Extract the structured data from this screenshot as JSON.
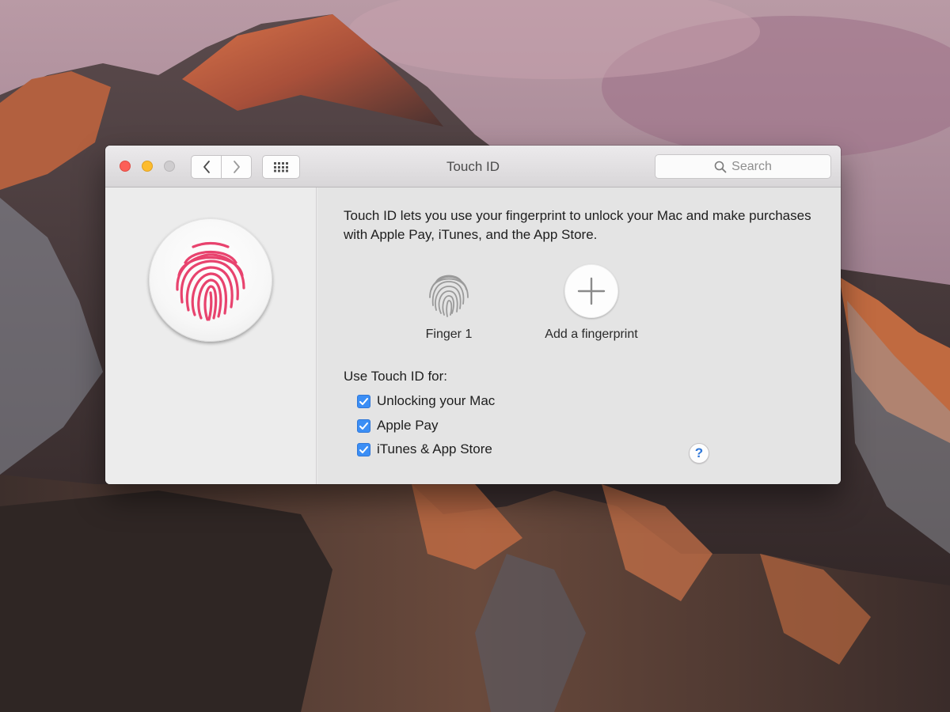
{
  "window": {
    "title": "Touch ID",
    "search_placeholder": "Search"
  },
  "toolbar": {
    "back_icon": "chevron-left-icon",
    "forward_icon": "chevron-right-icon",
    "show_all_icon": "grid-icon"
  },
  "content": {
    "intro": "Touch ID lets you use your fingerprint to unlock your Mac and make purchases with Apple Pay, iTunes, and the App Store.",
    "fingerprints": [
      {
        "label": "Finger 1"
      },
      {
        "label": "Add a fingerprint"
      }
    ],
    "use_heading": "Use Touch ID for:",
    "options": [
      {
        "label": "Unlocking your Mac",
        "checked": true
      },
      {
        "label": "Apple Pay",
        "checked": true
      },
      {
        "label": "iTunes & App Store",
        "checked": true
      }
    ],
    "help_label": "?"
  },
  "colors": {
    "accent": "#3b8ef5",
    "fingerprint_pink": "#e8436e",
    "close": "#fc5f57",
    "minimize": "#fdbc2e"
  }
}
